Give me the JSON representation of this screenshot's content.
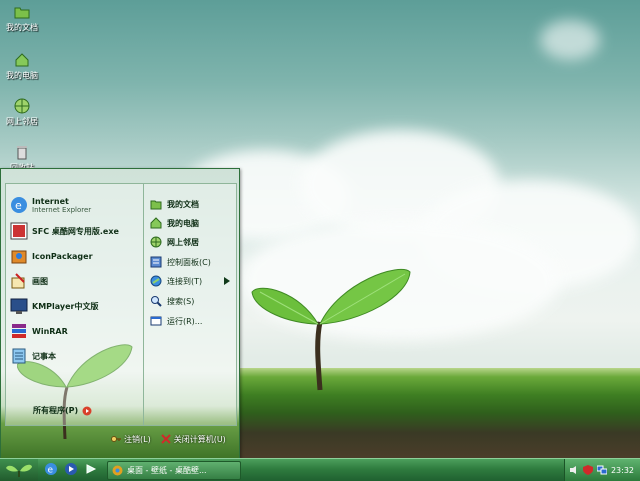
{
  "desktop_icons": [
    {
      "label": "我的文档",
      "icon": "folder-icon"
    },
    {
      "label": "我的电脑",
      "icon": "house-icon"
    },
    {
      "label": "网上邻居",
      "icon": "globe-icon"
    },
    {
      "label": "回收站",
      "icon": "recycle-bin-icon"
    }
  ],
  "start_menu": {
    "pinned": [
      {
        "title": "Internet",
        "subtitle": "Internet Explorer",
        "icon": "ie-icon"
      },
      {
        "title": "SFC 桌酷网专用版.exe",
        "icon": "sfc-icon"
      },
      {
        "title": "IconPackager",
        "icon": "iconpackager-icon"
      },
      {
        "title": "画图",
        "icon": "paint-icon"
      },
      {
        "title": "KMPlayer中文版",
        "icon": "kmplayer-icon"
      },
      {
        "title": "WinRAR",
        "icon": "winrar-icon"
      },
      {
        "title": "记事本",
        "icon": "notepad-icon"
      }
    ],
    "all_programs": "所有程序(P)",
    "right_items": [
      {
        "label": "我的文档",
        "icon": "folder-icon",
        "bold": true
      },
      {
        "label": "我的电脑",
        "icon": "house-icon",
        "bold": true
      },
      {
        "label": "网上邻居",
        "icon": "globe-icon",
        "bold": true
      },
      {
        "label": "控制面板(C)",
        "icon": "control-panel-icon",
        "bold": false
      },
      {
        "label": "连接到(T)",
        "icon": "connect-icon",
        "bold": false
      },
      {
        "label": "搜索(S)",
        "icon": "search-icon",
        "bold": false
      },
      {
        "label": "运行(R)...",
        "icon": "run-icon",
        "bold": false
      }
    ],
    "logoff": "注销(L)",
    "shutdown": "关闭计算机(U)"
  },
  "taskbar": {
    "task_label": "桌面 - 壁纸 - 桌酷壁...",
    "clock": "23:32"
  },
  "colors": {
    "accent": "#2f7c3f",
    "leaf": "#6cbf3c"
  }
}
